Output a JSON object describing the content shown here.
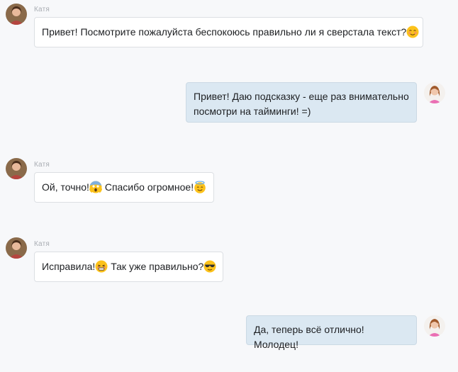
{
  "messages": [
    {
      "sender": "Катя",
      "direction": "in",
      "parts": [
        {
          "text": "Привет! Посмотрите пожалуйста беспокоюсь правильно ли я сверстала текст?"
        },
        {
          "emoji": "smiling-blush-emoji"
        }
      ]
    },
    {
      "direction": "out",
      "parts": [
        {
          "text": "Привет! Даю подсказку - еще раз внимательно посмотри на тайминги! =)"
        }
      ]
    },
    {
      "sender": "Катя",
      "direction": "in",
      "parts": [
        {
          "text": "Ой, точно!"
        },
        {
          "emoji": "screaming-face-emoji"
        },
        {
          "text": " Спасибо огромное!"
        },
        {
          "emoji": "halo-smile-emoji"
        }
      ]
    },
    {
      "sender": "Катя",
      "direction": "in",
      "parts": [
        {
          "text": "Исправила!"
        },
        {
          "emoji": "grinning-sweat-emoji"
        },
        {
          "text": " Так уже правильно?"
        },
        {
          "emoji": "sunglasses-emoji"
        }
      ]
    },
    {
      "direction": "out",
      "parts": [
        {
          "text": "Да, теперь всё отлично! Молодец!"
        }
      ]
    }
  ],
  "colors": {
    "background": "#f7f8fa",
    "incoming_bubble": "#ffffff",
    "outgoing_bubble": "#dbe8f2",
    "sender_name": "#a9adb3"
  }
}
